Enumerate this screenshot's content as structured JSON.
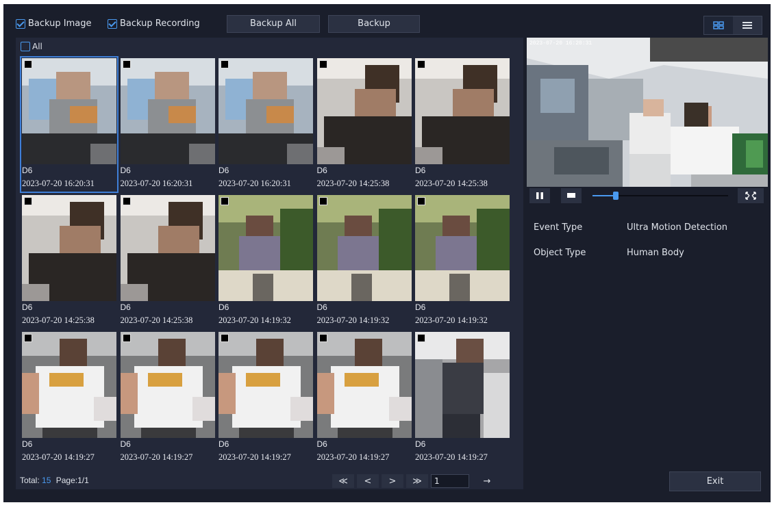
{
  "toolbar": {
    "backup_image_label": "Backup Image",
    "backup_recording_label": "Backup Recording",
    "backup_all_label": "Backup All",
    "backup_label": "Backup"
  },
  "grid": {
    "all_label": "All",
    "tiles": [
      {
        "camera": "D6",
        "time": "2023-07-20 16:20:31",
        "scene": "blue"
      },
      {
        "camera": "D6",
        "time": "2023-07-20 16:20:31",
        "scene": "blue"
      },
      {
        "camera": "D6",
        "time": "2023-07-20 16:20:31",
        "scene": "blue"
      },
      {
        "camera": "D6",
        "time": "2023-07-20 14:25:38",
        "scene": "dark"
      },
      {
        "camera": "D6",
        "time": "2023-07-20 14:25:38",
        "scene": "dark"
      },
      {
        "camera": "D6",
        "time": "2023-07-20 14:25:38",
        "scene": "dark"
      },
      {
        "camera": "D6",
        "time": "2023-07-20 14:25:38",
        "scene": "dark"
      },
      {
        "camera": "D6",
        "time": "2023-07-20 14:19:32",
        "scene": "plant"
      },
      {
        "camera": "D6",
        "time": "2023-07-20 14:19:32",
        "scene": "plant"
      },
      {
        "camera": "D6",
        "time": "2023-07-20 14:19:32",
        "scene": "plant"
      },
      {
        "camera": "D6",
        "time": "2023-07-20 14:19:27",
        "scene": "white"
      },
      {
        "camera": "D6",
        "time": "2023-07-20 14:19:27",
        "scene": "white"
      },
      {
        "camera": "D6",
        "time": "2023-07-20 14:19:27",
        "scene": "white"
      },
      {
        "camera": "D6",
        "time": "2023-07-20 14:19:27",
        "scene": "white"
      },
      {
        "camera": "D6",
        "time": "2023-07-20 14:19:27",
        "scene": "walk"
      }
    ]
  },
  "footer": {
    "total_label": "Total:",
    "total_value": "15",
    "page_label": "Page:1/1",
    "page_input": "1"
  },
  "pager": {
    "first": "≪",
    "prev": "<",
    "next": ">",
    "last": "≫",
    "go": "→"
  },
  "preview": {
    "timestamp": "2023-07-20 16:20:31",
    "progress": 0.17
  },
  "details": {
    "event_type_label": "Event Type",
    "event_type_value": "Ultra Motion Detection",
    "object_type_label": "Object Type",
    "object_type_value": "Human Body"
  },
  "exit_label": "Exit",
  "colors": {
    "background": "#1a1e2b",
    "panel": "#232839",
    "accent": "#4a9af0"
  }
}
